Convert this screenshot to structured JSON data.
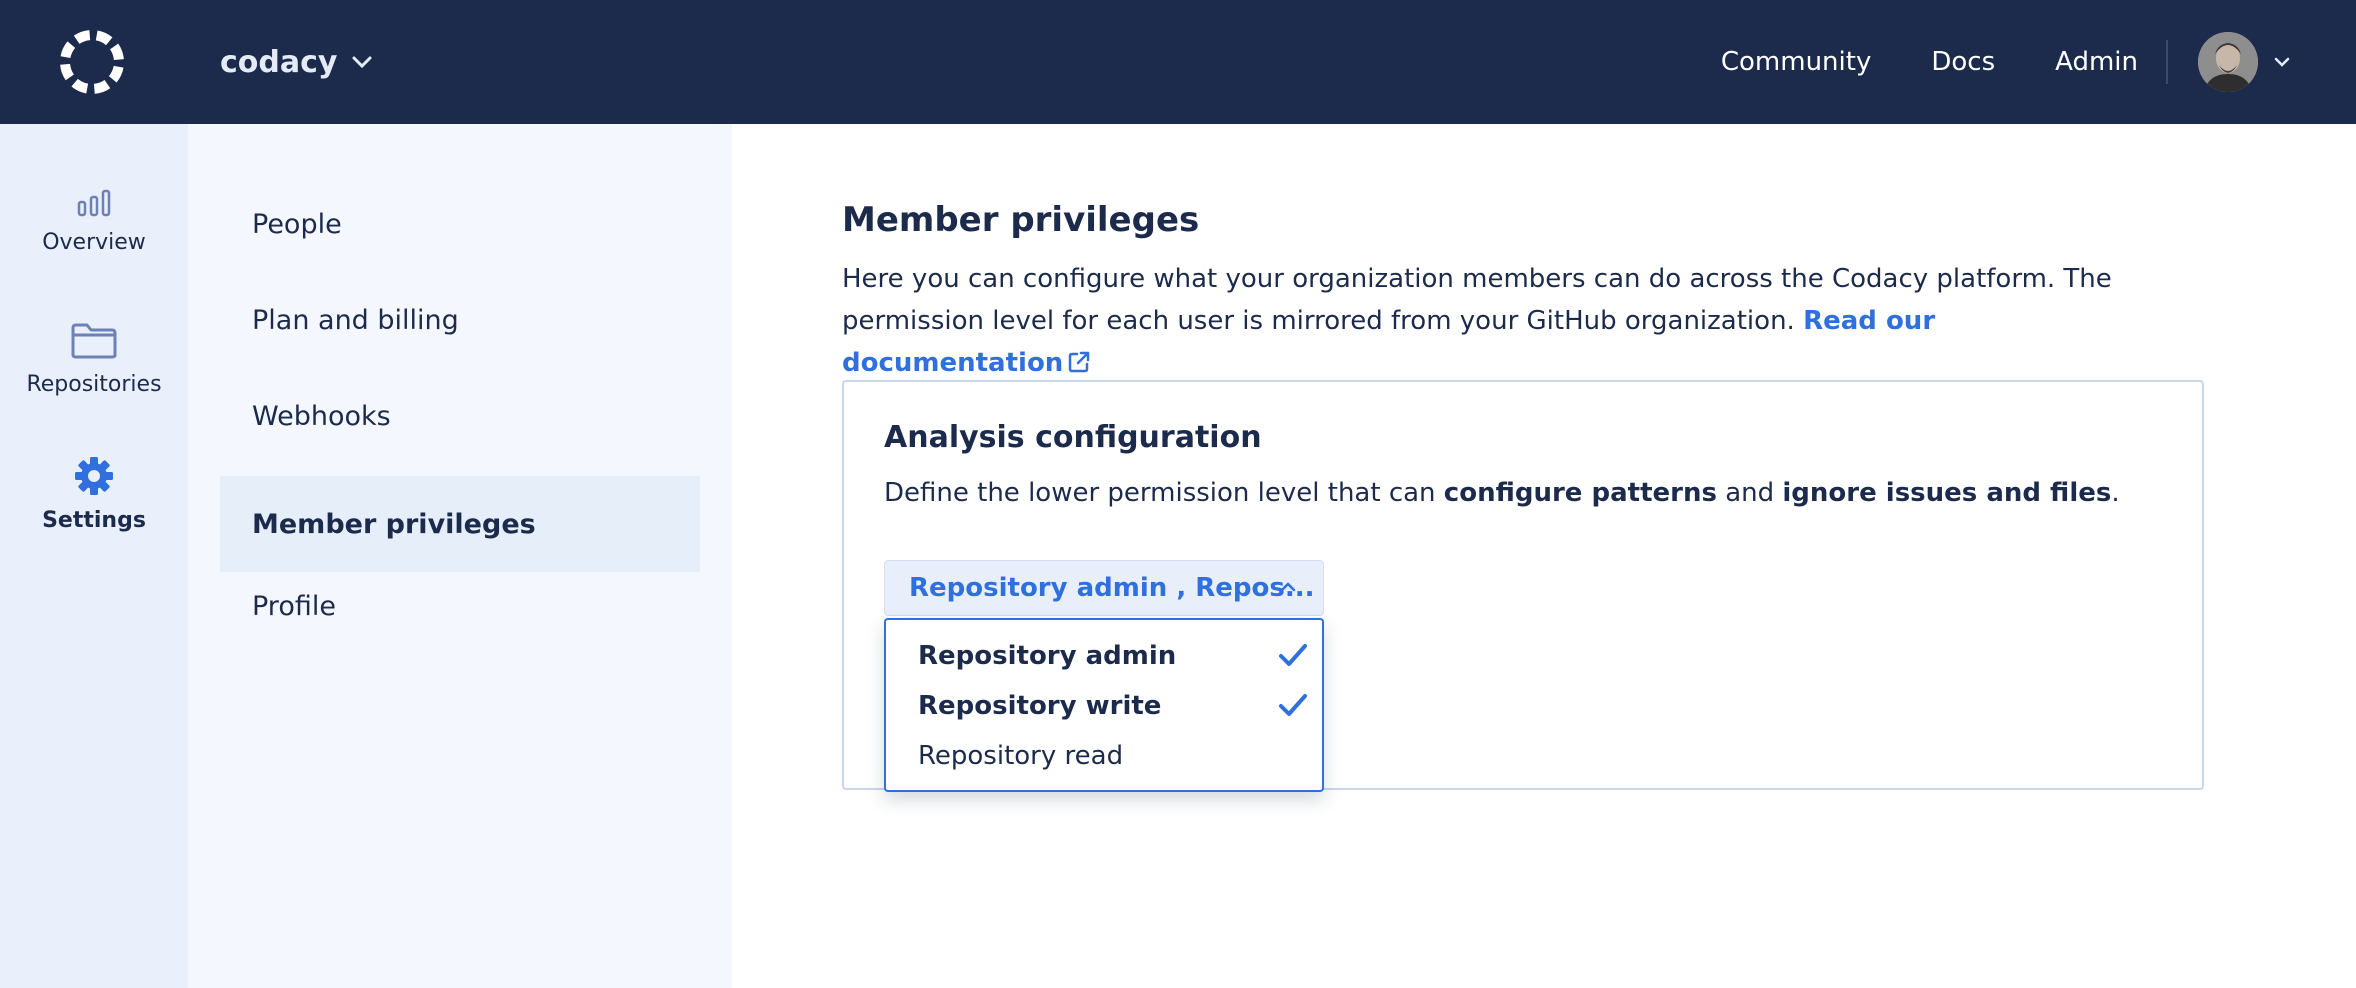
{
  "topbar": {
    "org_name": "codacy",
    "nav": {
      "community": "Community",
      "docs": "Docs",
      "admin": "Admin"
    },
    "colors": {
      "background": "#1c2b4b",
      "text": "#ffffff"
    }
  },
  "sidebar": {
    "items": [
      {
        "label": "Overview",
        "icon": "bar-chart-icon"
      },
      {
        "label": "Repositories",
        "icon": "folder-icon"
      },
      {
        "label": "Settings",
        "icon": "gear-icon",
        "active": true
      }
    ]
  },
  "settings_menu": {
    "items": [
      {
        "label": "People"
      },
      {
        "label": "Plan and billing"
      },
      {
        "label": "Webhooks"
      },
      {
        "label": "Member privileges",
        "active": true
      },
      {
        "label": "Profile"
      }
    ]
  },
  "main": {
    "title": "Member privileges",
    "description": "Here you can configure what your organization members can do across the Codacy platform. The permission level for each user is mirrored from your GitHub organization.",
    "doc_link": "Read our documentation",
    "card": {
      "title": "Analysis configuration",
      "desc_start": "Define the lower permission level that can ",
      "desc_bold1": "configure patterns",
      "desc_mid": " and ",
      "desc_bold2": "ignore issues and files",
      "desc_end": ".",
      "select": {
        "value": "Repository admin , Repos...",
        "options": [
          {
            "label": "Repository admin",
            "selected": true
          },
          {
            "label": "Repository write",
            "selected": true
          },
          {
            "label": "Repository read",
            "selected": false
          }
        ]
      }
    }
  },
  "accent_color": "#2f6fde"
}
